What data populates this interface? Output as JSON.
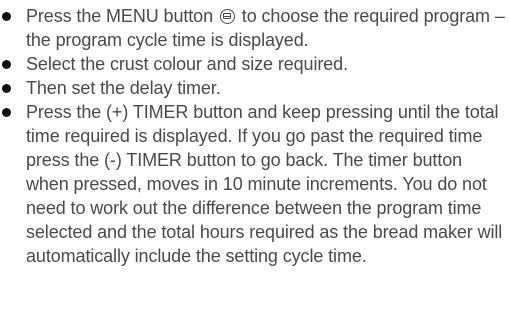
{
  "bullets": [
    {
      "before_icon": "Press the MENU button ",
      "icon": "menu-button-icon",
      "after_icon": " to choose the required program – the program cycle time is displayed."
    },
    {
      "text": "Select the crust colour and size required."
    },
    {
      "text": "Then set the delay timer."
    },
    {
      "text": "Press the (+) TIMER button and keep pressing until the total time required is displayed. If you go past the required time press the (-) TIMER button to go back. The timer button when pressed, moves in 10 minute increments. You do not need to work out the difference between the program time selected and the total hours required as the bread maker will automatically include the setting cycle time."
    }
  ],
  "colors": {
    "text": "#4a4a4a",
    "bullet": "#111111",
    "background": "#ffffff"
  }
}
